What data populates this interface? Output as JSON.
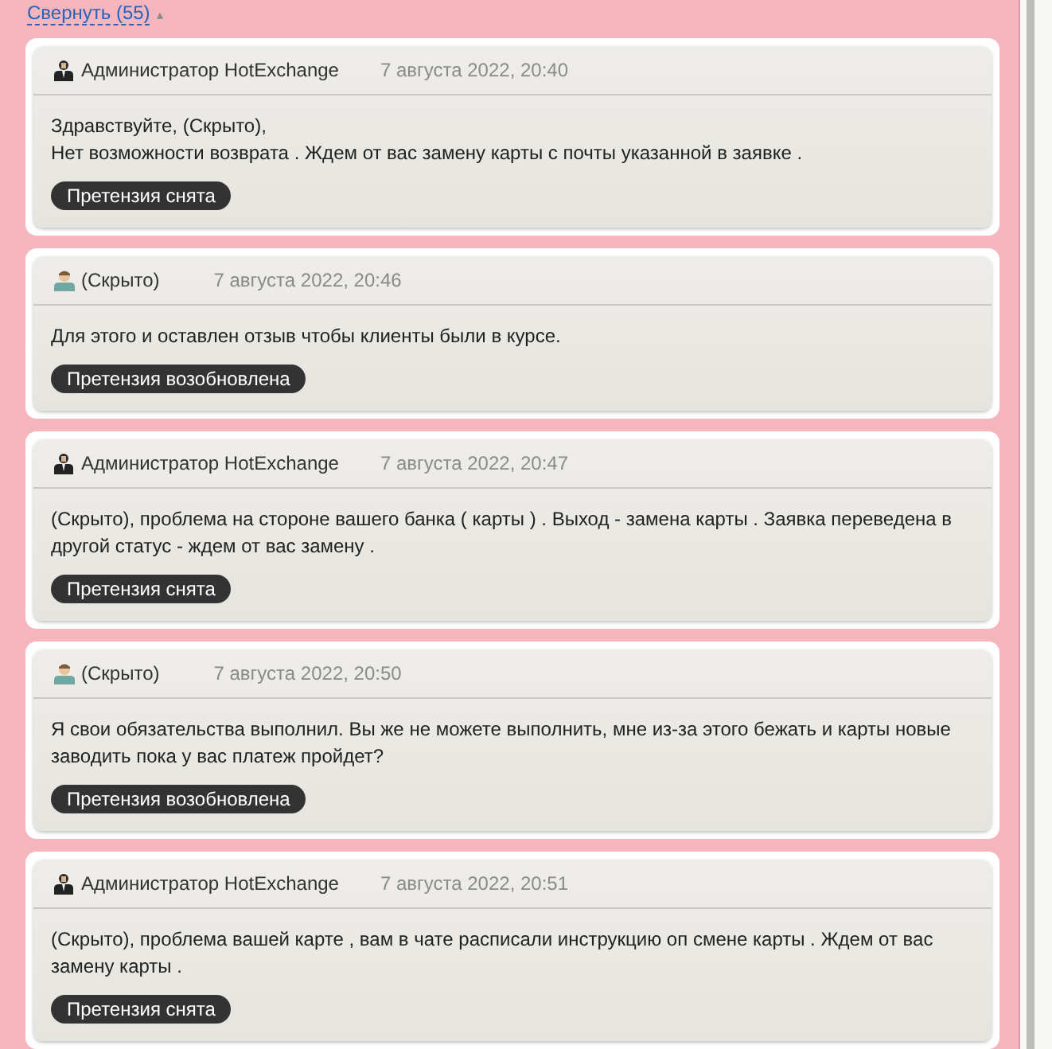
{
  "collapse_link": {
    "label": "Свернуть (55)",
    "arrow": "▴"
  },
  "messages": [
    {
      "author": "Администратор HotExchange",
      "kind": "admin",
      "time": "7 августа 2022, 20:40",
      "text": [
        "Здравствуйте, (Скрыто),",
        "Нет возможности возврата . Ждем от вас замену карты с почты указанной в заявке ."
      ],
      "status": "Претензия снята"
    },
    {
      "author": "(Скрыто)",
      "kind": "user",
      "time": "7 августа 2022, 20:46",
      "text": [
        "Для этого и оставлен отзыв чтобы клиенты были в курсе."
      ],
      "status": "Претензия возобновлена"
    },
    {
      "author": "Администратор HotExchange",
      "kind": "admin",
      "time": "7 августа 2022, 20:47",
      "text": [
        "(Скрыто), проблема на стороне вашего банка ( карты ) . Выход - замена карты . Заявка переведена в другой статус - ждем от вас замену ."
      ],
      "status": "Претензия снята"
    },
    {
      "author": "(Скрыто)",
      "kind": "user",
      "time": "7 августа 2022, 20:50",
      "text": [
        "Я свои обязательства выполнил. Вы же не можете выполнить, мне из-за этого бежать и карты новые заводить пока у вас платеж пройдет?"
      ],
      "status": "Претензия возобновлена"
    },
    {
      "author": "Администратор HotExchange",
      "kind": "admin",
      "time": "7 августа 2022, 20:51",
      "text": [
        "(Скрыто), проблема вашей карте , вам в чате расписали инструкцию оп смене карты . Ждем от вас замену карты ."
      ],
      "status": "Претензия снята"
    }
  ]
}
